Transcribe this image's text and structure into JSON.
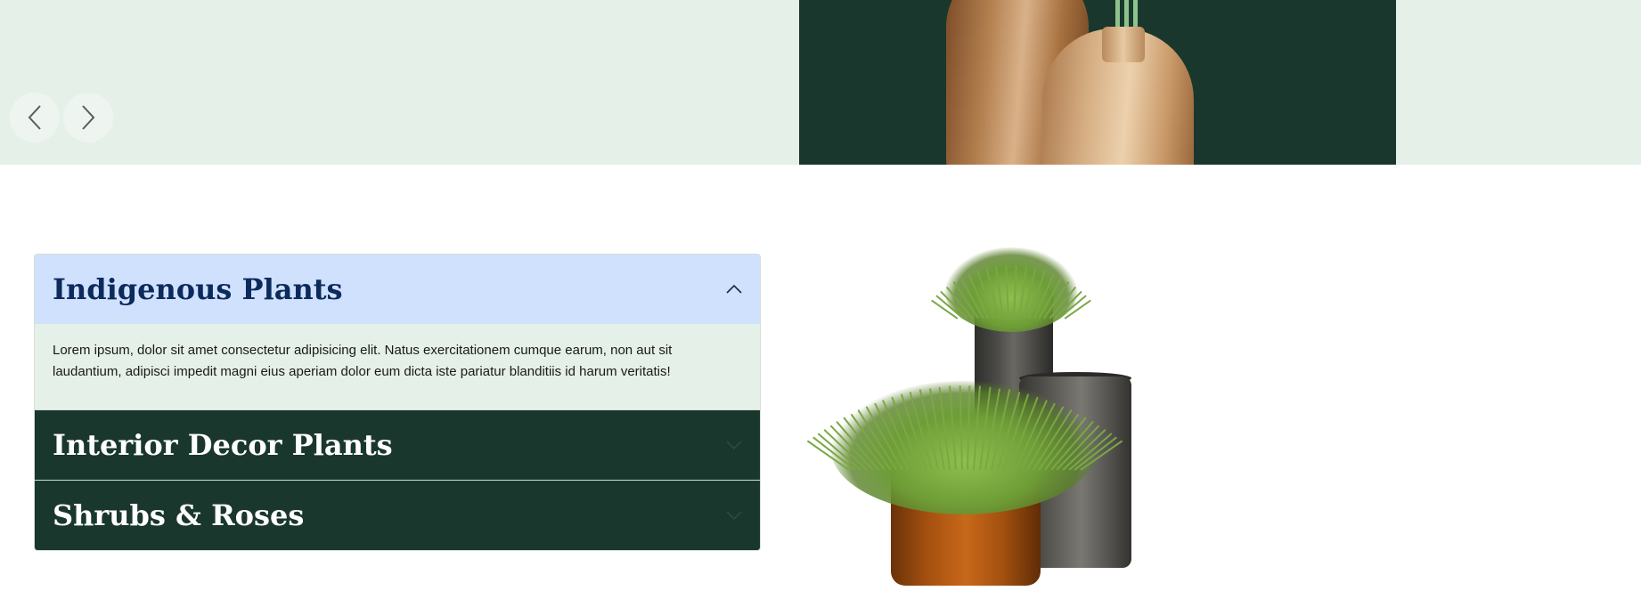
{
  "carousel": {
    "prev_icon": "chevron-left-icon",
    "next_icon": "chevron-right-icon",
    "slide_colors": {
      "band": "#e5f0e8",
      "slide": "#1a372e"
    }
  },
  "accordion": {
    "items": [
      {
        "title": "Indigenous Plants",
        "expanded": true,
        "icon": "chevron-up-icon",
        "body": "Lorem ipsum, dolor sit amet consectetur adipisicing elit. Natus exercitationem cumque earum, non aut sit laudantium, adipisci impedit magni eius aperiam dolor eum dicta iste pariatur blanditiis id harum veritatis!"
      },
      {
        "title": "Interior Decor Plants",
        "expanded": false,
        "icon": "chevron-down-icon"
      },
      {
        "title": "Shrubs & Roses",
        "expanded": false,
        "icon": "chevron-down-icon"
      }
    ],
    "colors": {
      "active_header": "#cfe1fc",
      "active_title": "#0c2a5b",
      "collapsed_header": "#1a372e",
      "body_bg": "#e5f0e8"
    }
  }
}
